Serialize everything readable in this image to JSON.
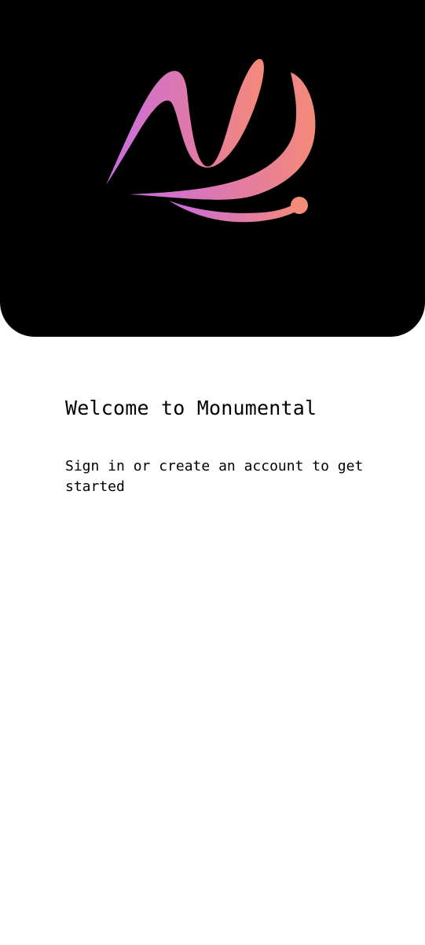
{
  "hero": {
    "logo": {
      "icon": "butterfly-m-logo-icon",
      "gradient_start": "#c86de0",
      "gradient_mid": "#e07aa8",
      "gradient_end": "#f48a78"
    },
    "background": "#000000"
  },
  "welcome": {
    "title": "Welcome to Monumental",
    "subtitle": "Sign in or create an account to get started"
  }
}
